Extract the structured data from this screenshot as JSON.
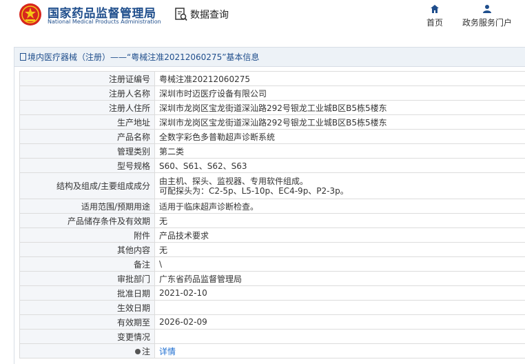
{
  "header": {
    "site_name_cn": "国家药品监督管理局",
    "site_name_en": "National Medical Products Administration",
    "data_query": "数据查询",
    "nav": [
      {
        "label": "首页",
        "icon": "home-icon"
      },
      {
        "label": "政务服务门户",
        "icon": "user-icon"
      }
    ],
    "brand_color": "#1f4e8c"
  },
  "panel": {
    "title": "境内医疗器械（注册）——“粤械注准20212060275”基本信息"
  },
  "rows": [
    {
      "key": "注册证编号",
      "value": "粤械注准20212060275"
    },
    {
      "key": "注册人名称",
      "value": "深圳市时迈医疗设备有限公司"
    },
    {
      "key": "注册人住所",
      "value": "深圳市龙岗区宝龙街道深汕路292号银龙工业城B区B5栋5楼东"
    },
    {
      "key": "生产地址",
      "value": "深圳市龙岗区宝龙街道深汕路292号银龙工业城B区B5栋5楼东"
    },
    {
      "key": "产品名称",
      "value": "全数字彩色多普勒超声诊断系统"
    },
    {
      "key": "管理类别",
      "value": "第二类"
    },
    {
      "key": "型号规格",
      "value": "S60、S61、S62、S63"
    },
    {
      "key": "结构及组成/主要组成成分",
      "value_line1": "由主机、探头、监视器、专用软件组成。",
      "value_line2": "可配探头为：C2-5p、L5-10p、EC4-9p、P2-3p。"
    },
    {
      "key": "适用范围/预期用途",
      "value": "适用于临床超声诊断检查。"
    },
    {
      "key": "产品储存条件及有效期",
      "value": "无"
    },
    {
      "key": "附件",
      "value": "产品技术要求"
    },
    {
      "key": "其他内容",
      "value": "无"
    },
    {
      "key": "备注",
      "value": "\\"
    },
    {
      "key": "审批部门",
      "value": "广东省药品监督管理局"
    },
    {
      "key": "批准日期",
      "value": "2021-02-10"
    },
    {
      "key": "生效日期",
      "value": ""
    },
    {
      "key": "有效期至",
      "value": "2026-02-09"
    },
    {
      "key": "变更情况",
      "value": ""
    },
    {
      "key": "注",
      "value": "详情"
    }
  ]
}
